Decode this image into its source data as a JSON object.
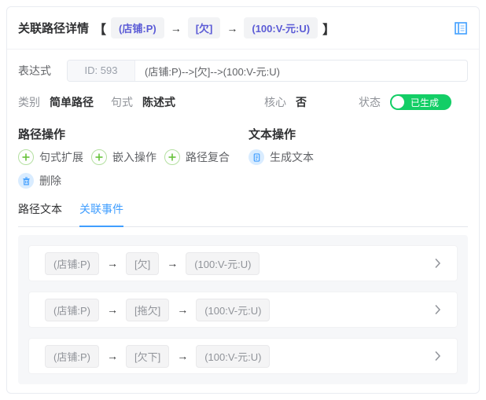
{
  "header": {
    "title": "关联路径详情",
    "bracket_open": "【",
    "bracket_close": "】",
    "arrow": "→",
    "path_nodes": [
      "(店铺:P)",
      "[欠]",
      "(100:V-元:U)"
    ]
  },
  "expression": {
    "label": "表达式",
    "id_badge": "ID: 593",
    "value": "(店铺:P)-->[欠]-->(100:V-元:U)"
  },
  "meta": {
    "category": {
      "label": "类别",
      "value": "简单路径"
    },
    "syntax": {
      "label": "句式",
      "value": "陈述式"
    },
    "core": {
      "label": "核心",
      "value": "否"
    },
    "status": {
      "label": "状态",
      "value": "已生成",
      "on": true
    }
  },
  "path_operations": {
    "title": "路径操作",
    "add_buttons": [
      {
        "label": "句式扩展"
      },
      {
        "label": "嵌入操作"
      },
      {
        "label": "路径复合"
      }
    ],
    "delete_button": {
      "label": "删除"
    }
  },
  "text_operations": {
    "title": "文本操作",
    "generate_button": {
      "label": "生成文本"
    }
  },
  "tabs": {
    "items": [
      {
        "label": "路径文本",
        "active": false
      },
      {
        "label": "关联事件",
        "active": true
      }
    ]
  },
  "events": {
    "arrow": "→",
    "rows": [
      {
        "nodes": [
          "(店铺:P)",
          "[欠]",
          "(100:V-元:U)"
        ]
      },
      {
        "nodes": [
          "(店铺:P)",
          "[拖欠]",
          "(100:V-元:U)"
        ]
      },
      {
        "nodes": [
          "(店铺:P)",
          "[欠下]",
          "(100:V-元:U)"
        ]
      }
    ]
  },
  "colors": {
    "accent_blue": "#409eff",
    "badge_purple": "#5b5bd6",
    "success_green": "#13ce66",
    "plus_green": "#67c23a"
  }
}
